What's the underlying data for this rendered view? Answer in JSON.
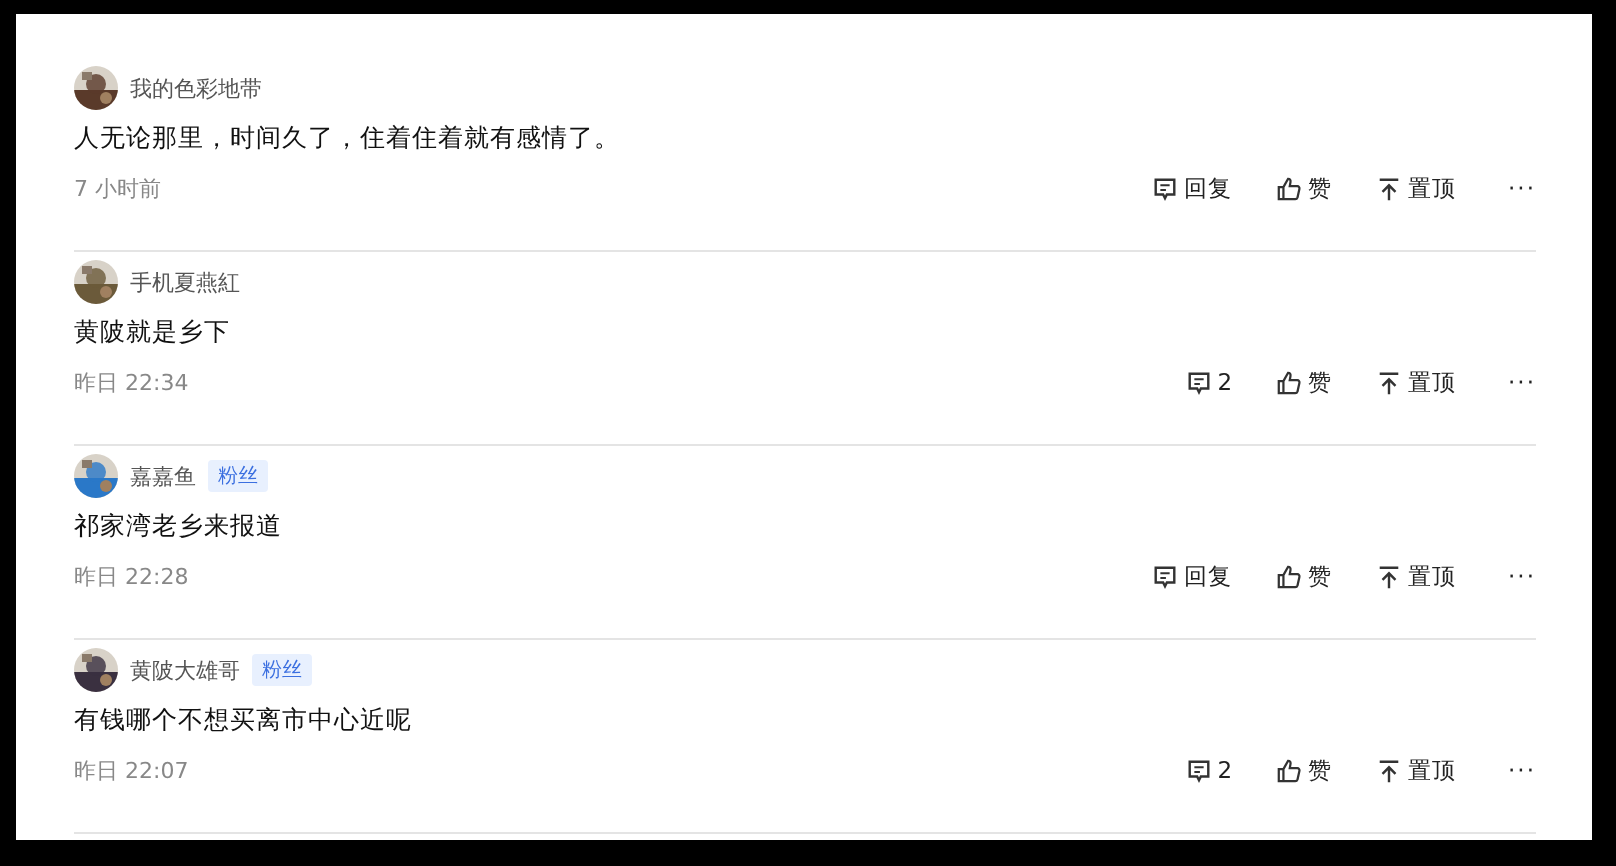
{
  "comments": [
    {
      "author": "我的色彩地带",
      "text": "人无论那里，时间久了，住着住着就有感情了。",
      "time": "7 小时前",
      "reply": "回复",
      "like": "赞",
      "pin": "置顶",
      "more": "···"
    },
    {
      "author": "手机夏燕紅",
      "text": "黄陂就是乡下",
      "time": "昨日 22:34",
      "reply": "2",
      "like": "赞",
      "pin": "置顶",
      "more": "···"
    },
    {
      "author": "嘉嘉鱼",
      "badge": "粉丝",
      "text": "祁家湾老乡来报道",
      "time": "昨日 22:28",
      "reply": "回复",
      "like": "赞",
      "pin": "置顶",
      "more": "···"
    },
    {
      "author": "黄陂大雄哥",
      "badge": "粉丝",
      "text": "有钱哪个不想买离市中心近呢",
      "time": "昨日 22:07",
      "reply": "2",
      "like": "赞",
      "pin": "置顶",
      "more": "···"
    }
  ]
}
